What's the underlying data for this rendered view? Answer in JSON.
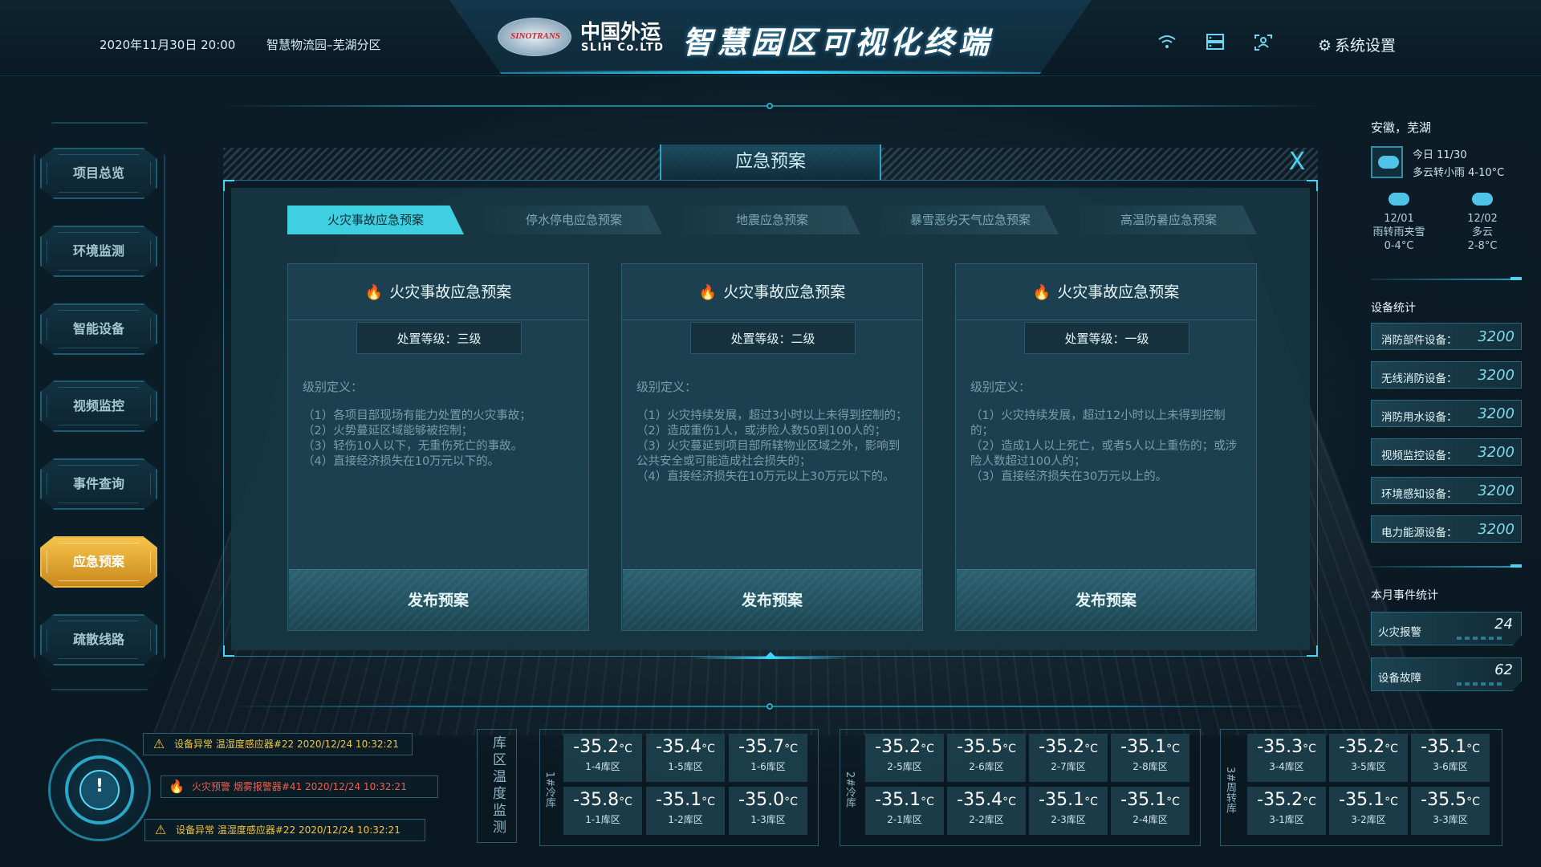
{
  "header": {
    "datetime": "2020年11月30日  20:00",
    "location": "智慧物流园–芜湖分区",
    "logo_text": "SINOTRANS",
    "brand_cn": "中国外运",
    "brand_en": "SLIH Co.LTD",
    "title": "智慧园区可视化终端",
    "icons": [
      "wifi-icon",
      "server-icon",
      "user-scan-icon"
    ],
    "settings_label": "系统设置"
  },
  "nav": {
    "items": [
      {
        "label": "项目总览",
        "active": false
      },
      {
        "label": "环境监测",
        "active": false
      },
      {
        "label": "智能设备",
        "active": false
      },
      {
        "label": "视频监控",
        "active": false
      },
      {
        "label": "事件查询",
        "active": false
      },
      {
        "label": "应急预案",
        "active": true
      },
      {
        "label": "疏散线路",
        "active": false
      }
    ]
  },
  "modal": {
    "title": "应急预案",
    "close": "X",
    "tabs": [
      {
        "label": "火灾事故应急预案",
        "active": true
      },
      {
        "label": "停水停电应急预案",
        "active": false
      },
      {
        "label": "地震应急预案",
        "active": false
      },
      {
        "label": "暴雪恶劣天气应急预案",
        "active": false
      },
      {
        "label": "高温防暑应急预案",
        "active": false
      }
    ],
    "cards": [
      {
        "title": "火灾事故应急预案",
        "level": "处置等级：三级",
        "def_label": "级别定义：",
        "definition": "（1）各项目部现场有能力处置的火灾事故；\n（2）火势蔓延区域能够被控制；\n（3）轻伤10人以下，无重伤死亡的事故。\n（4）直接经济损失在10万元以下的。",
        "button": "发布预案"
      },
      {
        "title": "火灾事故应急预案",
        "level": "处置等级：二级",
        "def_label": "级别定义：",
        "definition": "（1）火灾持续发展，超过3小时以上未得到控制的；\n（2）造成重伤1人，或涉险人数50到100人的；\n（3）火灾蔓延到项目部所辖物业区域之外，影响到公共安全或可能造成社会损失的；\n（4）直接经济损失在10万元以上30万元以下的。",
        "button": "发布预案"
      },
      {
        "title": "火灾事故应急预案",
        "level": "处置等级：一级",
        "def_label": "级别定义：",
        "definition": "（1）火灾持续发展，超过12小时以上未得到控制的；\n（2）造成1人以上死亡，或者5人以上重伤的；或涉险人数超过100人的；\n（3）直接经济损失在30万元以上的。",
        "button": "发布预案"
      }
    ]
  },
  "weather": {
    "city": "安徽，芜湖",
    "today_date": "今日 11/30",
    "today_desc": "多云转小雨  4-10°C",
    "days": [
      {
        "date": "12/01",
        "desc": "雨转雨夹雪",
        "temp": "0-4°C"
      },
      {
        "date": "12/02",
        "desc": "多云",
        "temp": "2-8°C"
      }
    ]
  },
  "device_stats": {
    "title": "设备统计",
    "items": [
      {
        "label": "消防部件设备：",
        "value": "3200"
      },
      {
        "label": "无线消防设备：",
        "value": "3200"
      },
      {
        "label": "消防用水设备：",
        "value": "3200"
      },
      {
        "label": "视频监控设备：",
        "value": "3200"
      },
      {
        "label": "环境感知设备：",
        "value": "3200"
      },
      {
        "label": "电力能源设备：",
        "value": "3200"
      }
    ]
  },
  "event_stats": {
    "title": "本月事件统计",
    "items": [
      {
        "label": "火灾报警",
        "value": "24"
      },
      {
        "label": "设备故障",
        "value": "62"
      }
    ]
  },
  "alarms": [
    {
      "type": "warn",
      "text": "设备异常 温湿度感应器#22 2020/12/24 10:32:21"
    },
    {
      "type": "fire",
      "text": "火灾预警  烟雾报警器#41 2020/12/24 10:32:21"
    },
    {
      "type": "warn",
      "text": "设备异常 温湿度感应器#22 2020/12/24 10:32:21"
    }
  ],
  "temp_monitor": {
    "title": "库区温度监测",
    "unit": "°C",
    "groups": [
      {
        "label": "1#冷库",
        "cells": [
          {
            "value": "-35.2",
            "zone": "1-4库区"
          },
          {
            "value": "-35.4",
            "zone": "1-5库区"
          },
          {
            "value": "-35.7",
            "zone": "1-6库区"
          },
          {
            "value": "-35.8",
            "zone": "1-1库区"
          },
          {
            "value": "-35.1",
            "zone": "1-2库区"
          },
          {
            "value": "-35.0",
            "zone": "1-3库区"
          }
        ]
      },
      {
        "label": "2#冷库",
        "cells": [
          {
            "value": "-35.2",
            "zone": "2-5库区"
          },
          {
            "value": "-35.5",
            "zone": "2-6库区"
          },
          {
            "value": "-35.2",
            "zone": "2-7库区"
          },
          {
            "value": "-35.1",
            "zone": "2-8库区"
          },
          {
            "value": "-35.1",
            "zone": "2-1库区"
          },
          {
            "value": "-35.4",
            "zone": "2-2库区"
          },
          {
            "value": "-35.1",
            "zone": "2-3库区"
          },
          {
            "value": "-35.1",
            "zone": "2-4库区"
          }
        ]
      },
      {
        "label": "3#周转库",
        "cells": [
          {
            "value": "-35.3",
            "zone": "3-4库区"
          },
          {
            "value": "-35.2",
            "zone": "3-5库区"
          },
          {
            "value": "-35.1",
            "zone": "3-6库区"
          },
          {
            "value": "-35.2",
            "zone": "3-1库区"
          },
          {
            "value": "-35.1",
            "zone": "3-2库区"
          },
          {
            "value": "-35.5",
            "zone": "3-3库区"
          }
        ]
      }
    ]
  }
}
